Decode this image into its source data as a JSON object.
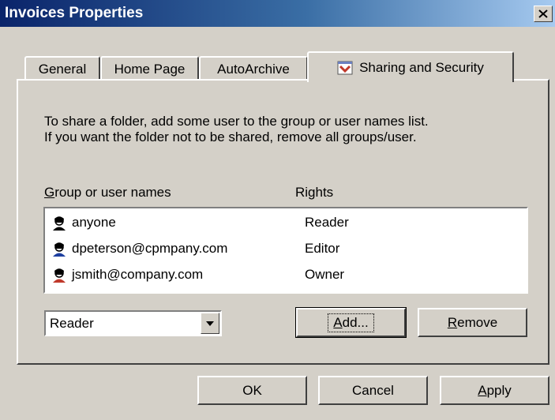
{
  "window": {
    "title": "Invoices Properties"
  },
  "tabs": [
    {
      "label": "General"
    },
    {
      "label": "Home Page"
    },
    {
      "label": "AutoArchive"
    },
    {
      "label": "Sharing and Security",
      "active": true
    }
  ],
  "description": {
    "line1": "To share a folder, add some user to the group or user names list.",
    "line2": "If you want the folder not to be shared, remove all groups/user."
  },
  "list": {
    "header_name": "roup or user names",
    "header_name_mnemonic": "G",
    "header_rights": "Rights",
    "rows": [
      {
        "name": "anyone",
        "rights": "Reader",
        "icon": "user-icon"
      },
      {
        "name": "dpeterson@cpmpany.com",
        "rights": "Editor",
        "icon": "user-icon"
      },
      {
        "name": "jsmith@company.com",
        "rights": "Owner",
        "icon": "user-icon"
      }
    ]
  },
  "rights_select": {
    "value": "Reader"
  },
  "buttons": {
    "add_mnemonic": "A",
    "add_rest": "dd...",
    "remove_mnemonic": "R",
    "remove_rest": "emove",
    "ok": "OK",
    "cancel": "Cancel",
    "apply_mnemonic": "A",
    "apply_rest": "pply"
  },
  "colors": {
    "face": "#d4d0c8",
    "title_start": "#0a246a",
    "title_end": "#a6caf0"
  }
}
